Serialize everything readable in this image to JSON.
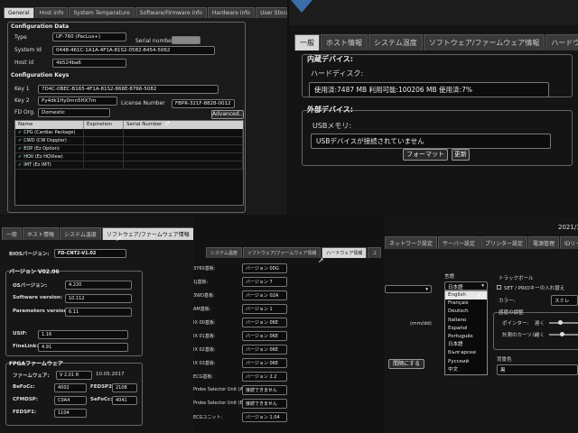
{
  "p1": {
    "tabs": [
      "General",
      "Host info",
      "System Temperature",
      "Software/Firmware info",
      "Hardware info",
      "User Storage Devices"
    ],
    "config_data_title": "Configuration Data",
    "type_label": "Type",
    "type_value": "UF-760 (PacLus+)",
    "serial_label": "Serial number",
    "system_id_label": "System Id",
    "system_id_value": "0448-461C-1A1A-4F1A-81S2-0582-8454-5062",
    "host_id_label": "Host id",
    "host_id_value": "4b524ba6",
    "config_keys_title": "Configuration Keys",
    "key1_label": "Key 1",
    "key1_value": "7D4C-0BEC-B165-4F1A-81S2-868E-8766-5082",
    "key2_label": "Key 2",
    "key2_value": "Py4dk1Hy0mn5HX7m",
    "license_label": "License Number",
    "license_value": "FBPR-321F-8828-0012",
    "fd_org_label": "FD Org.",
    "fd_org_value": "Domestic",
    "advanced_label": "Advanced...",
    "table_headers": [
      "Name",
      "Expiration Date",
      "Serial Number"
    ],
    "licenses": [
      "CPG (Cardiac Package)",
      "CWD (CW Doppler)",
      "EOP (Ez Option)",
      "HOV (Ez HQView)",
      "IMT (Ez IMT)"
    ]
  },
  "p2": {
    "tabs": [
      "一般",
      "ホスト情報",
      "システム温度",
      "ソフトウェア/ファームウェア情報",
      "ハードウェ"
    ],
    "internal_title": "内蔵デバイス:",
    "hdd_label": "ハードディスク:",
    "hdd_value": "使用済:7487 MB 利用可能:100206 MB 使用済:7%",
    "external_title": "外部デバイス:",
    "usb_label": "USBメモリ:",
    "usb_value": "USBデバイスが接続されていません",
    "format_label": "フォーマット",
    "update_label": "更新"
  },
  "p3": {
    "tabs": [
      "一般",
      "ホスト情報",
      "システム温度",
      "ソフトウェア/ファームウェア情報",
      "ハ"
    ],
    "bios_label": "BIOSバージョン:",
    "bios_value": "FD-CNT2-V1.02",
    "version_title": "バージョン V02.06",
    "os_label": "OSバージョン:",
    "os_value": "4.220",
    "sw_label": "Software version:",
    "sw_value": "10.112",
    "param_label": "Parameters version:",
    "param_value": "6.11",
    "usif_label": "USIF:",
    "usif_value": "1.16",
    "finelink_label": "FineLink:",
    "finelink_value": "4.91",
    "fpga_title": "FPGAファームウェア",
    "fw_label": "ファームウェア:",
    "fw_value": "V 2.01 R",
    "fw_date": "10.05.2017",
    "befocc_label": "BeFoCc:",
    "befocc_value": "4002",
    "fedsp2_label": "FEDSP2:",
    "fedsp2_value": "2108",
    "cfmdsp_label": "CFMDSP:",
    "cfmdsp_value": "C0A4",
    "sefocc_label": "SeFoCc:",
    "sefocc_value": "4041",
    "fedsp1_label": "FEDSP1:",
    "fedsp1_value": "1104"
  },
  "p4": {
    "tabs": [
      "システム温度",
      "ソフトウェア/ファームウェア情報",
      "ハードウェア情報",
      "ユ"
    ],
    "rows": [
      {
        "label": "3760基板:",
        "value": "バージョン 00G"
      },
      {
        "label": "1J基板:",
        "value": "バージョン 7"
      },
      {
        "label": "3WD基板:",
        "value": "バージョン 02A"
      },
      {
        "label": "AM基板:",
        "value": "バージョン 1"
      },
      {
        "label": "IX 00基板:",
        "value": "バージョン 06E"
      },
      {
        "label": "IX 01基板:",
        "value": "バージョン 06E"
      },
      {
        "label": "IX 02基板:",
        "value": "バージョン 06E"
      },
      {
        "label": "IX 03基板:",
        "value": "バージョン 06E"
      },
      {
        "label": "ECG基板:",
        "value": "バージョン 2.2"
      },
      {
        "label": "Probe Selector Unit (A):",
        "value": "接続できません"
      },
      {
        "label": "Probe Selector Unit (B):",
        "value": "接続できません"
      },
      {
        "label": "ECGユニット:",
        "value": "バージョン 1.04"
      }
    ]
  },
  "p5": {
    "clock": "2021/1",
    "tabs": [
      "ネットワーク設定",
      "サーバー設定",
      "プリンター設定",
      "電源管理",
      "IDリーダ"
    ],
    "lang_label": "言語",
    "lang_value": "日本語",
    "languages": [
      "English",
      "Français",
      "Deutsch",
      "Italiano",
      "Español",
      "Português",
      "日本語",
      "Български",
      "Русский",
      "中文"
    ],
    "date_fmt": "(mm/dd)",
    "trackball_title": "トラックボール",
    "set_prio_label": "SET / PRIOキーの入れ替え",
    "color_label": "カラー:",
    "color_value": "スミレ",
    "sensitivity_title": "感度の調整",
    "pointer_label": "ポインター:",
    "slow1": "遅く",
    "measure_label": "計測のカーソル:",
    "slow2": "遅く",
    "reset_label": "間隔にする",
    "bg_label": "背景色",
    "bg_value": "黒"
  }
}
